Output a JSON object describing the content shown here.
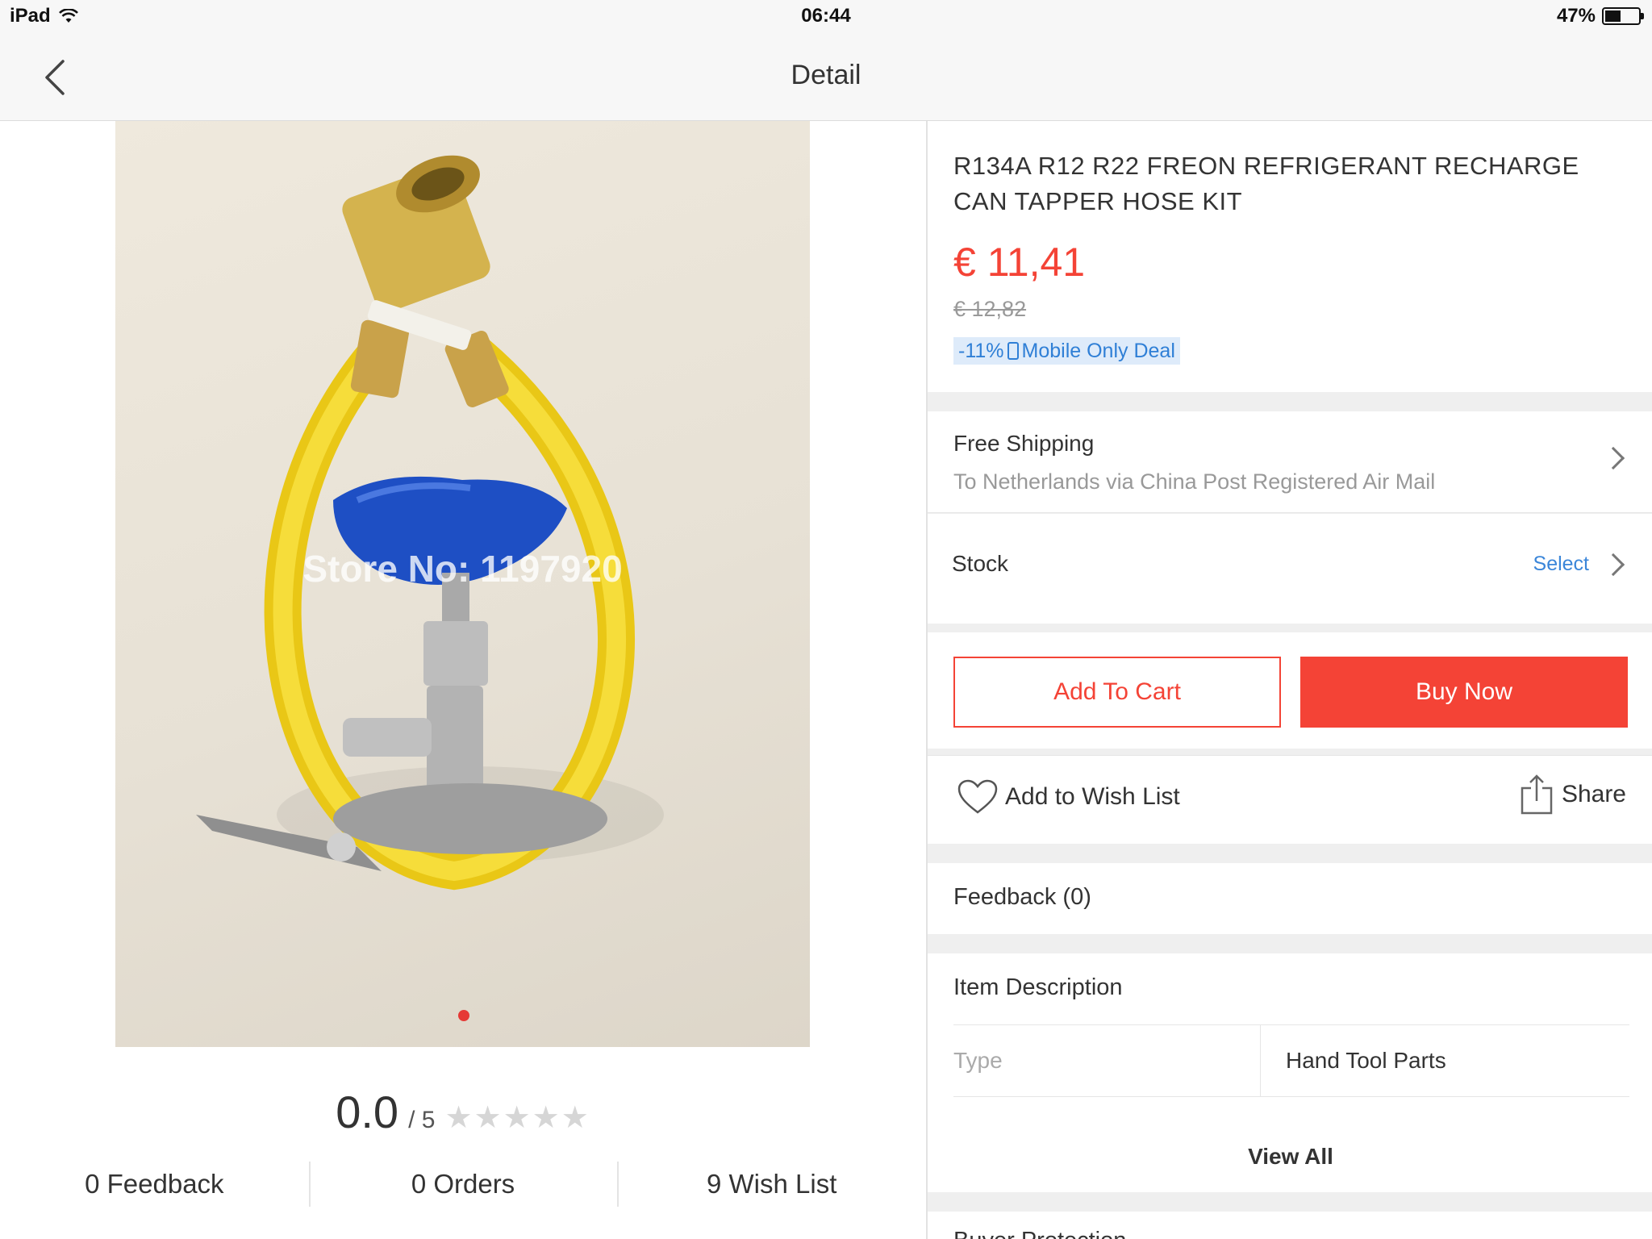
{
  "status_bar": {
    "device": "iPad",
    "time": "06:44",
    "battery_percent_label": "47%",
    "battery_level": 0.47
  },
  "nav": {
    "title": "Detail"
  },
  "gallery": {
    "watermark": "Store No: 1197920",
    "page_count": 1,
    "active_page": 1
  },
  "rating": {
    "score": "0.0",
    "out_of": "/ 5",
    "stars": 0
  },
  "stats": [
    "0 Feedback",
    "0 Orders",
    "9 Wish List"
  ],
  "product": {
    "title": "R134A R12 R22 FREON REFRIGERANT RECHARGE CAN TAPPER HOSE KIT",
    "price": "€ 11,41",
    "original_price": "€ 12,82",
    "deal_discount": "-11%",
    "deal_label": "Mobile Only Deal"
  },
  "shipping": {
    "heading": "Free Shipping",
    "detail": "To Netherlands via China Post Registered Air Mail"
  },
  "stock": {
    "label": "Stock",
    "select_label": "Select"
  },
  "actions": {
    "add_to_cart": "Add To Cart",
    "buy_now": "Buy Now",
    "wish_list": "Add to Wish List",
    "share": "Share"
  },
  "feedback": {
    "label": "Feedback (0)"
  },
  "description": {
    "heading": "Item Description",
    "rows": [
      {
        "key": "Type",
        "value": "Hand Tool Parts"
      }
    ],
    "view_all": "View All"
  },
  "buyer_protection": {
    "heading": "Buyer Protection"
  },
  "colors": {
    "accent": "#f44336",
    "link": "#3b86d9",
    "hose_yellow": "#f2d21a",
    "knob_blue": "#1e4fc4"
  }
}
